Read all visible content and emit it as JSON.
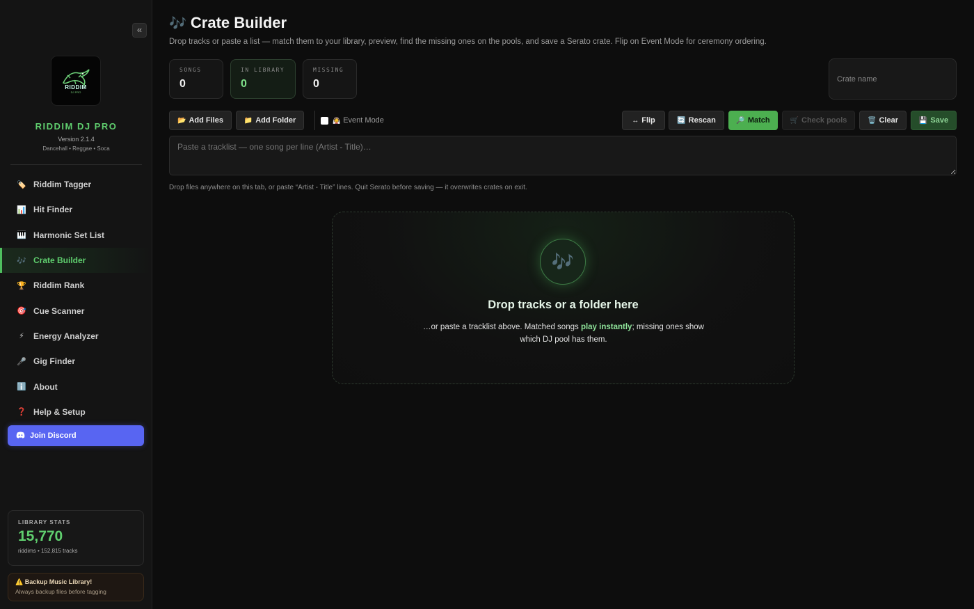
{
  "sidebar": {
    "collapse_label": "«",
    "logo_text": "RIDDIM",
    "logo_sub": "DJ PRO",
    "brand": "RIDDIM DJ PRO",
    "version": "Version 2.1.4",
    "genres": "Dancehall • Reggae • Soca",
    "nav": [
      {
        "label": "Riddim Tagger",
        "icon": "tag-icon"
      },
      {
        "label": "Hit Finder",
        "icon": "chart-icon"
      },
      {
        "label": "Harmonic Set List",
        "icon": "piano-icon"
      },
      {
        "label": "Crate Builder",
        "icon": "music-notes-icon",
        "active": true
      },
      {
        "label": "Riddim Rank",
        "icon": "trophy-icon"
      },
      {
        "label": "Cue Scanner",
        "icon": "target-icon"
      },
      {
        "label": "Energy Analyzer",
        "icon": "lightning-icon"
      },
      {
        "label": "Gig Finder",
        "icon": "microphone-icon"
      },
      {
        "label": "About",
        "icon": "info-icon"
      },
      {
        "label": "Help & Setup",
        "icon": "question-icon"
      }
    ],
    "discord_label": "Join Discord",
    "stats": {
      "label": "LIBRARY STATS",
      "value": "15,770",
      "sub": "riddims • 152,815 tracks"
    },
    "backup": {
      "title": "Backup Music Library!",
      "sub": "Always backup files before tagging"
    }
  },
  "main": {
    "title": "Crate Builder",
    "description": "Drop tracks or paste a list — match them to your library, preview, find the missing ones on the pools, and save a Serato crate. Flip on Event Mode for ceremony ordering.",
    "stats": [
      {
        "label": "SONGS",
        "value": "0"
      },
      {
        "label": "IN LIBRARY",
        "value": "0"
      },
      {
        "label": "MISSING",
        "value": "0"
      }
    ],
    "crate_name_placeholder": "Crate name",
    "buttons": {
      "add_files": "Add Files",
      "add_folder": "Add Folder",
      "event_mode": "Event Mode",
      "flip": "Flip",
      "rescan": "Rescan",
      "match": "Match",
      "check_pools": "Check pools",
      "clear": "Clear",
      "save": "Save"
    },
    "tracklist_placeholder": "Paste a tracklist — one song per line (Artist - Title)…",
    "hint": "Drop files anywhere on this tab, or paste “Artist - Title” lines. Quit Serato before saving — it overwrites crates on exit.",
    "dropzone": {
      "title": "Drop tracks or a folder here",
      "body_pre": "…or paste a tracklist above. Matched songs ",
      "body_highlight": "play instantly",
      "body_post": "; missing ones show which DJ pool has them."
    }
  },
  "colors": {
    "accent": "#4caf50",
    "brand": "#5fce6e",
    "discord": "#5865f2"
  }
}
